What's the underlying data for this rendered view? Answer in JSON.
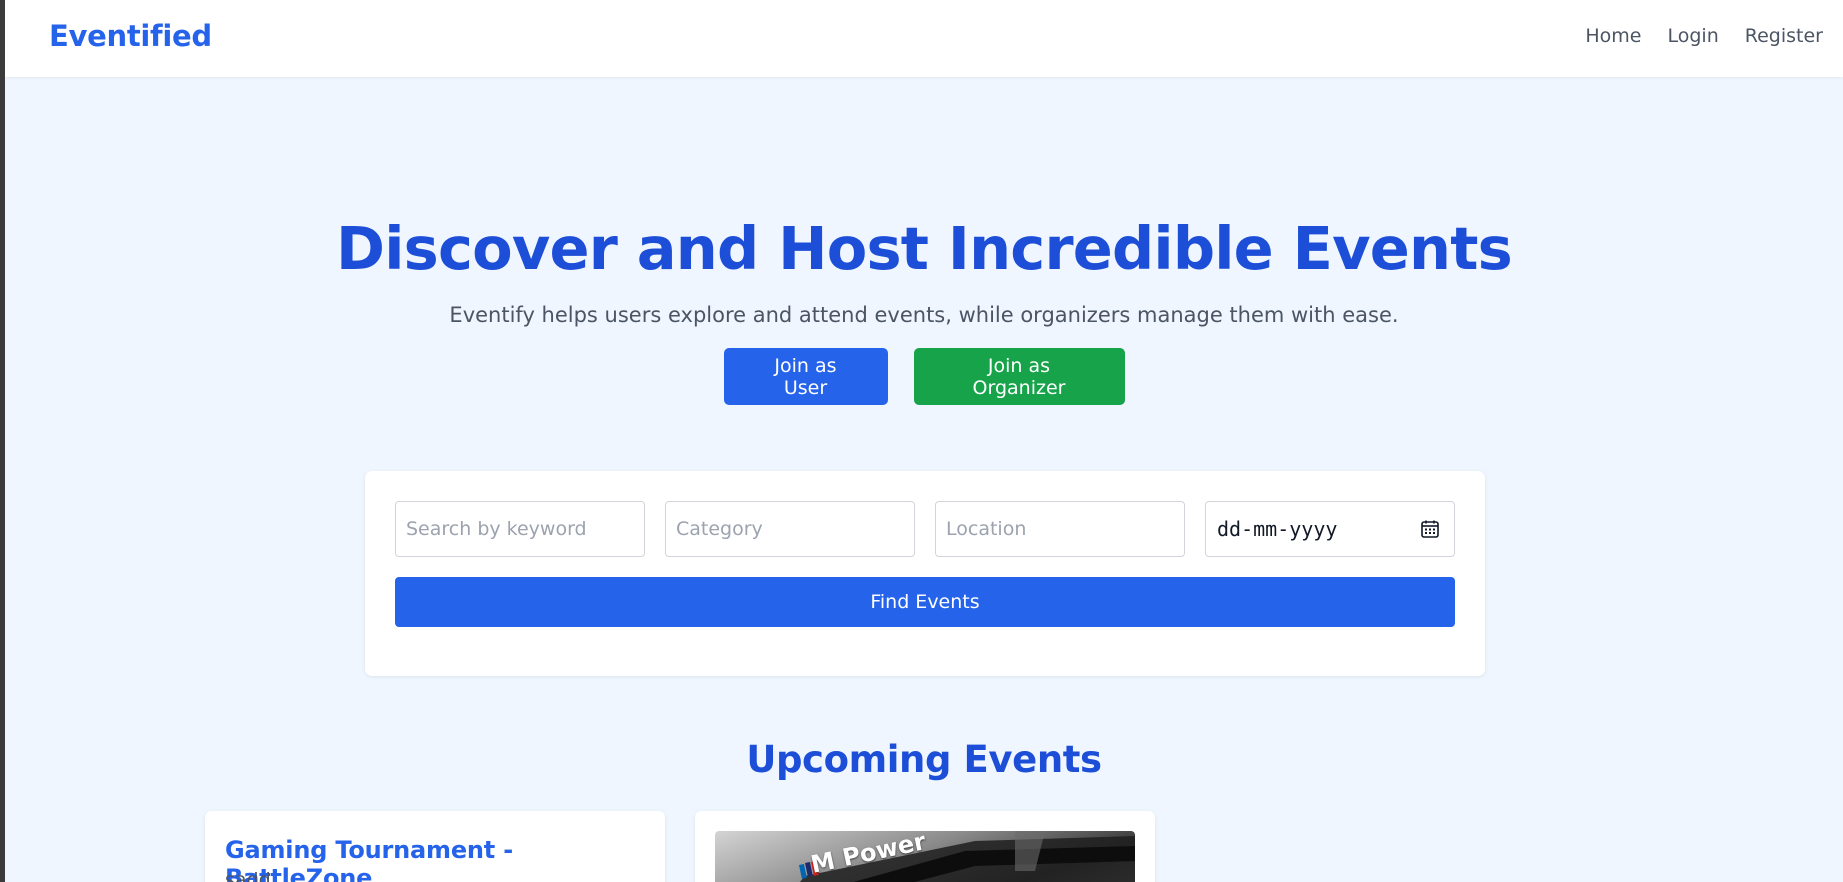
{
  "navbar": {
    "brand": "Eventified",
    "links": [
      "Home",
      "Login",
      "Register"
    ]
  },
  "hero": {
    "title": "Discover and Host Incredible Events",
    "subtitle": "Eventify helps users explore and attend events, while organizers manage them with ease.",
    "join_user": "Join as User",
    "join_organizer": "Join as Organizer"
  },
  "search": {
    "keyword_placeholder": "Search by keyword",
    "category_placeholder": "Category",
    "location_placeholder": "Location",
    "date_placeholder": "dd-mm-yyyy",
    "find_label": "Find Events"
  },
  "upcoming": {
    "title": "Upcoming Events",
    "events": [
      {
        "title": "Gaming Tournament - BattleZone",
        "description": "sadd"
      },
      {
        "image_text": "M Power"
      }
    ]
  },
  "colors": {
    "brand_blue": "#2563eb",
    "heading_blue": "#1d4ed8",
    "organizer_green": "#16a34a",
    "page_bg": "#eff6ff"
  },
  "icons": {
    "date": "calendar-icon"
  }
}
